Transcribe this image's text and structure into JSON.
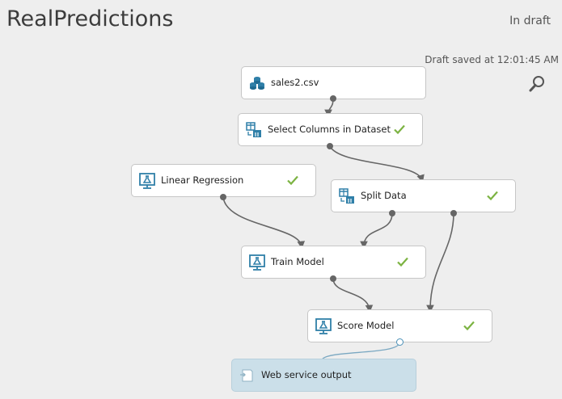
{
  "header": {
    "title": "RealPredictions",
    "status": "In draft",
    "saved_text": "Draft saved at 12:01:45 AM"
  },
  "nodes": {
    "sales_csv": {
      "label": "sales2.csv",
      "icon": "dataset-icon"
    },
    "select_columns": {
      "label": "Select Columns in Dataset",
      "icon": "table-transform-icon",
      "completed": true
    },
    "linear_regression": {
      "label": "Linear Regression",
      "icon": "flask-screen-icon",
      "completed": true
    },
    "split_data": {
      "label": "Split Data",
      "icon": "table-transform-icon",
      "completed": true
    },
    "train_model": {
      "label": "Train Model",
      "icon": "flask-screen-icon",
      "completed": true
    },
    "score_model": {
      "label": "Score Model",
      "icon": "flask-screen-icon",
      "completed": true
    },
    "web_service_output": {
      "label": "Web service output",
      "icon": "web-service-icon"
    }
  },
  "colors": {
    "check": "#7cb342",
    "icon_blue": "#2f7fa8",
    "edge": "#666666",
    "output_bg": "#cbdfe9"
  }
}
